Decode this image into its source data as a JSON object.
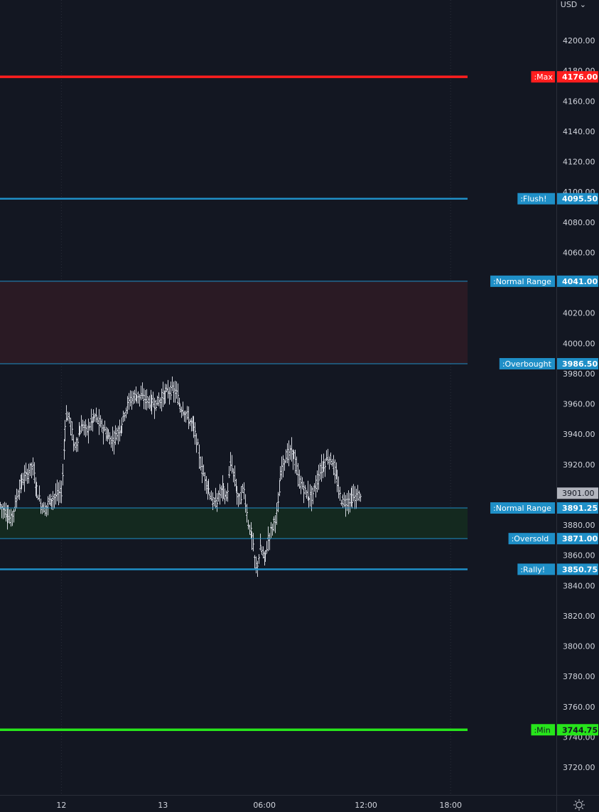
{
  "header": {
    "currency": "USD",
    "currency_chevron": "⌄"
  },
  "colors": {
    "background": "#131722",
    "grid": "#2a2e39",
    "axis_text": "#d1d4dc",
    "bar": "#d1d4dc",
    "max_line": "#ff1e1e",
    "min_line": "#27e51b",
    "level_line": "#1f8fc7",
    "label_bg": "#1f8fc7",
    "overbought_zone": "#2a1a24",
    "oversold_zone": "#14291f",
    "last_price_bg": "#b2b5be"
  },
  "chart_data": {
    "type": "bar",
    "style": "ohlc",
    "currency": "USD",
    "ylim": [
      3700,
      4215
    ],
    "yticks": [
      3720,
      3740,
      3760,
      3780,
      3800,
      3820,
      3840,
      3860,
      3880,
      3900,
      3920,
      3940,
      3960,
      3980,
      4000,
      4020,
      4040,
      4060,
      4080,
      4100,
      4120,
      4140,
      4160,
      4180,
      4200
    ],
    "ytick_labels": [
      "3720.00",
      "3740.00",
      "3760.00",
      "3780.00",
      "3800.00",
      "3820.00",
      "3840.00",
      "3860.00",
      "3880.00",
      "3900.00",
      "3920.00",
      "3940.00",
      "3960.00",
      "3980.00",
      "4000.00",
      "4020.00",
      "4040.00",
      "4060.00",
      "4080.00",
      "4100.00",
      "4120.00",
      "4140.00",
      "4160.00",
      "4180.00",
      "4200.00"
    ],
    "xticks": [
      {
        "label": "12",
        "hour": 10
      },
      {
        "label": "13",
        "hour": 34
      },
      {
        "label": "06:00",
        "hour": 58
      },
      {
        "label": "12:00",
        "hour": 82
      },
      {
        "label": "18:00",
        "hour": 102
      }
    ],
    "x_range_hours": [
      -4.5,
      106
    ],
    "grid_x_hours": [
      10,
      102
    ],
    "last_price": {
      "value": 3901.0,
      "label": "3901.00"
    },
    "levels": [
      {
        "name": ":Max",
        "value": 4176.0,
        "value_label": "4176.00",
        "kind": "max"
      },
      {
        "name": ":Flush!",
        "value": 4095.5,
        "value_label": "4095.50",
        "kind": "level"
      },
      {
        "name": ":Normal Range",
        "value": 4041.0,
        "value_label": "4041.00",
        "kind": "level"
      },
      {
        "name": ":Overbought",
        "value": 3986.5,
        "value_label": "3986.50",
        "kind": "level"
      },
      {
        "name": ":Normal Range",
        "value": 3891.25,
        "value_label": "3891.25",
        "kind": "level"
      },
      {
        "name": ":Oversold",
        "value": 3871.0,
        "value_label": "3871.00",
        "kind": "level"
      },
      {
        "name": ":Rally!",
        "value": 3850.75,
        "value_label": "3850.75",
        "kind": "level"
      },
      {
        "name": ":Min",
        "value": 3744.75,
        "value_label": "3744.75",
        "kind": "min"
      }
    ],
    "zones": [
      {
        "from": 3986.5,
        "to": 4041.0,
        "kind": "overbought"
      },
      {
        "from": 3871.0,
        "to": 3891.25,
        "kind": "oversold"
      }
    ],
    "price_path": [
      [
        -4.5,
        3893
      ],
      [
        -3,
        3888
      ],
      [
        -2,
        3883
      ],
      [
        -1,
        3893
      ],
      [
        0,
        3905
      ],
      [
        1,
        3910
      ],
      [
        2,
        3914
      ],
      [
        3,
        3920
      ],
      [
        4,
        3905
      ],
      [
        5,
        3895
      ],
      [
        6,
        3890
      ],
      [
        7,
        3896
      ],
      [
        8,
        3898
      ],
      [
        9,
        3900
      ],
      [
        10,
        3902
      ],
      [
        11,
        3953
      ],
      [
        12,
        3950
      ],
      [
        13,
        3930
      ],
      [
        14,
        3940
      ],
      [
        15,
        3946
      ],
      [
        16,
        3942
      ],
      [
        17,
        3948
      ],
      [
        18,
        3952
      ],
      [
        19,
        3947
      ],
      [
        20,
        3943
      ],
      [
        21,
        3938
      ],
      [
        22,
        3936
      ],
      [
        23,
        3940
      ],
      [
        24,
        3945
      ],
      [
        25,
        3955
      ],
      [
        26,
        3962
      ],
      [
        27,
        3965
      ],
      [
        28,
        3966
      ],
      [
        29,
        3964
      ],
      [
        30,
        3963
      ],
      [
        31,
        3961
      ],
      [
        32,
        3960
      ],
      [
        33,
        3962
      ],
      [
        34,
        3965
      ],
      [
        35,
        3968
      ],
      [
        36,
        3969
      ],
      [
        37,
        3968
      ],
      [
        38,
        3958
      ],
      [
        39,
        3956
      ],
      [
        40,
        3950
      ],
      [
        41,
        3946
      ],
      [
        42,
        3935
      ],
      [
        43,
        3918
      ],
      [
        44,
        3910
      ],
      [
        45,
        3902
      ],
      [
        46,
        3893
      ],
      [
        47,
        3898
      ],
      [
        48,
        3905
      ],
      [
        49,
        3897
      ],
      [
        50,
        3922
      ],
      [
        51,
        3908
      ],
      [
        52,
        3895
      ],
      [
        53,
        3905
      ],
      [
        54,
        3882
      ],
      [
        55,
        3872
      ],
      [
        56,
        3850
      ],
      [
        57,
        3865
      ],
      [
        58,
        3857
      ],
      [
        59,
        3872
      ],
      [
        60,
        3880
      ],
      [
        61,
        3890
      ],
      [
        62,
        3918
      ],
      [
        63,
        3925
      ],
      [
        64,
        3928
      ],
      [
        65,
        3926
      ],
      [
        66,
        3910
      ],
      [
        67,
        3905
      ],
      [
        68,
        3900
      ],
      [
        69,
        3898
      ],
      [
        70,
        3905
      ],
      [
        71,
        3915
      ],
      [
        72,
        3920
      ],
      [
        73,
        3925
      ],
      [
        74,
        3922
      ],
      [
        75,
        3910
      ],
      [
        76,
        3897
      ],
      [
        77,
        3895
      ],
      [
        78,
        3897
      ],
      [
        79,
        3898
      ],
      [
        80,
        3899
      ],
      [
        80.8,
        3901
      ]
    ]
  }
}
